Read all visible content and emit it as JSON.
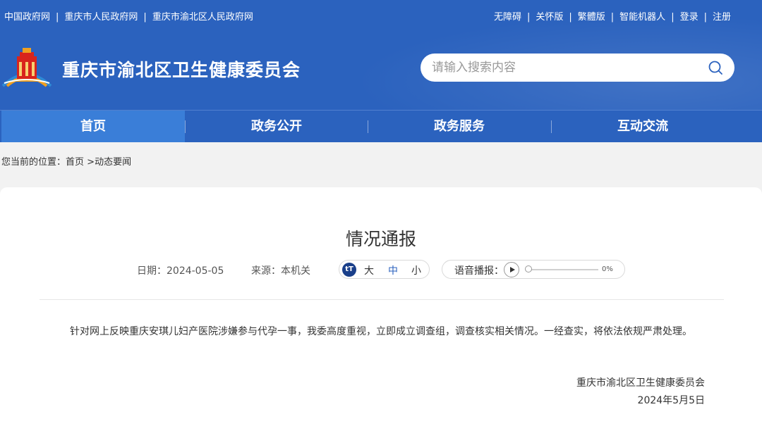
{
  "top_links_left": [
    "中国政府网",
    "重庆市人民政府网",
    "重庆市渝北区人民政府网"
  ],
  "top_links_right": [
    "无障碍",
    "关怀版",
    "繁體版",
    "智能机器人",
    "登录",
    "注册"
  ],
  "site_title": "重庆市渝北区卫生健康委员会",
  "search": {
    "placeholder": "请输入搜索内容"
  },
  "nav": [
    "首页",
    "政务公开",
    "政务服务",
    "互动交流"
  ],
  "breadcrumb": {
    "prefix": "您当前的位置：",
    "home": "首页",
    "current": "动态要闻"
  },
  "article": {
    "title": "情况通报",
    "date": "日期：2024-05-05",
    "source": "来源：本机关",
    "font_sizes": [
      "大",
      "中",
      "小"
    ],
    "font_icon": "tT",
    "audio_label": "语音播报：",
    "audio_progress": "0%",
    "body": "针对网上反映重庆安琪儿妇产医院涉嫌参与代孕一事，我委高度重视，立即成立调查组，调查核实相关情况。一经查实，将依法依规严肃处理。",
    "signer": "重庆市渝北区卫生健康委员会",
    "sign_date": "2024年5月5日"
  },
  "colors": {
    "header_blue": "#2b62be",
    "nav_active": "#3a7ed8",
    "logo_red": "#d9241c",
    "logo_gold": "#f0a020"
  },
  "icons": {
    "logo": "emblem-icon",
    "search": "search-icon",
    "play": "play-icon"
  }
}
